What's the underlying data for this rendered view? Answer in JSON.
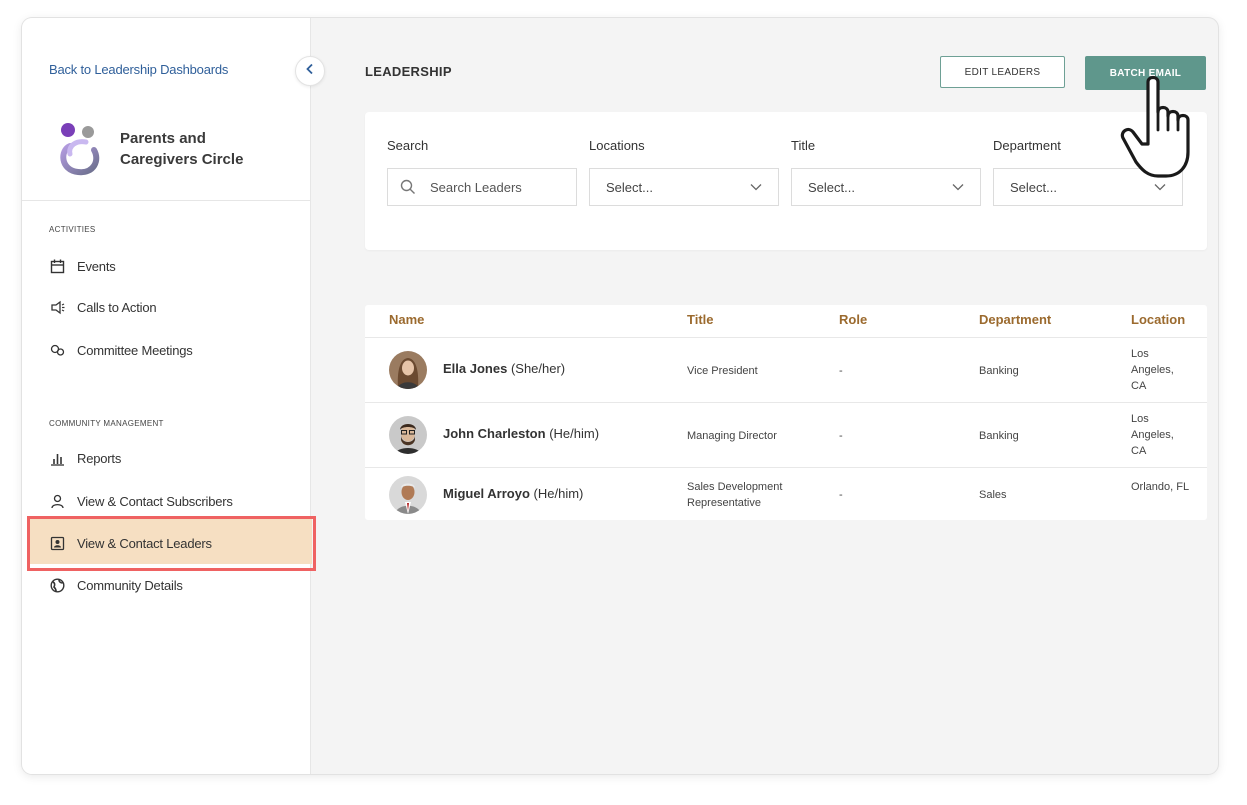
{
  "sidebar": {
    "back_link": "Back to Leadership Dashboards",
    "org_name": "Parents and Caregivers Circle",
    "sections": [
      {
        "label": "ACTIVITIES",
        "items": [
          "Events",
          "Calls to Action",
          "Committee Meetings"
        ]
      },
      {
        "label": "COMMUNITY MANAGEMENT",
        "items": [
          "Reports",
          "View & Contact Subscribers",
          "View & Contact Leaders",
          "Community Details"
        ]
      }
    ],
    "active_item": "View & Contact Leaders"
  },
  "header": {
    "title": "LEADERSHIP",
    "edit_button": "EDIT LEADERS",
    "batch_button": "BATCH EMAIL"
  },
  "filters": {
    "search": {
      "label": "Search",
      "placeholder": "Search Leaders"
    },
    "locations": {
      "label": "Locations",
      "value": "Select..."
    },
    "title": {
      "label": "Title",
      "value": "Select..."
    },
    "department": {
      "label": "Department",
      "value": "Select..."
    }
  },
  "table": {
    "columns": [
      "Name",
      "Title",
      "Role",
      "Department",
      "Location"
    ],
    "rows": [
      {
        "name": "Ella Jones",
        "pronouns": "(She/her)",
        "title": "Vice President",
        "role": "-",
        "department": "Banking",
        "location": "Los Angeles, CA"
      },
      {
        "name": "John Charleston",
        "pronouns": "(He/him)",
        "title": "Managing Director",
        "role": "-",
        "department": "Banking",
        "location": "Los Angeles, CA"
      },
      {
        "name": "Miguel Arroyo",
        "pronouns": "(He/him)",
        "title": "Sales Development Representative",
        "role": "-",
        "department": "Sales",
        "location": "Orlando, FL"
      }
    ]
  },
  "colors": {
    "accent": "#5f978c",
    "active_nav_bg": "#f6dfc2",
    "highlight_border": "#ef6262",
    "table_header": "#9b6a2e",
    "link": "#2f5f9a"
  },
  "icons": [
    "chevron-left-icon",
    "calendar-icon",
    "megaphone-icon",
    "committee-icon",
    "bar-chart-icon",
    "person-icon",
    "contact-card-icon",
    "globe-icon",
    "search-icon",
    "chevron-down-icon",
    "hand-pointer-cursor"
  ]
}
